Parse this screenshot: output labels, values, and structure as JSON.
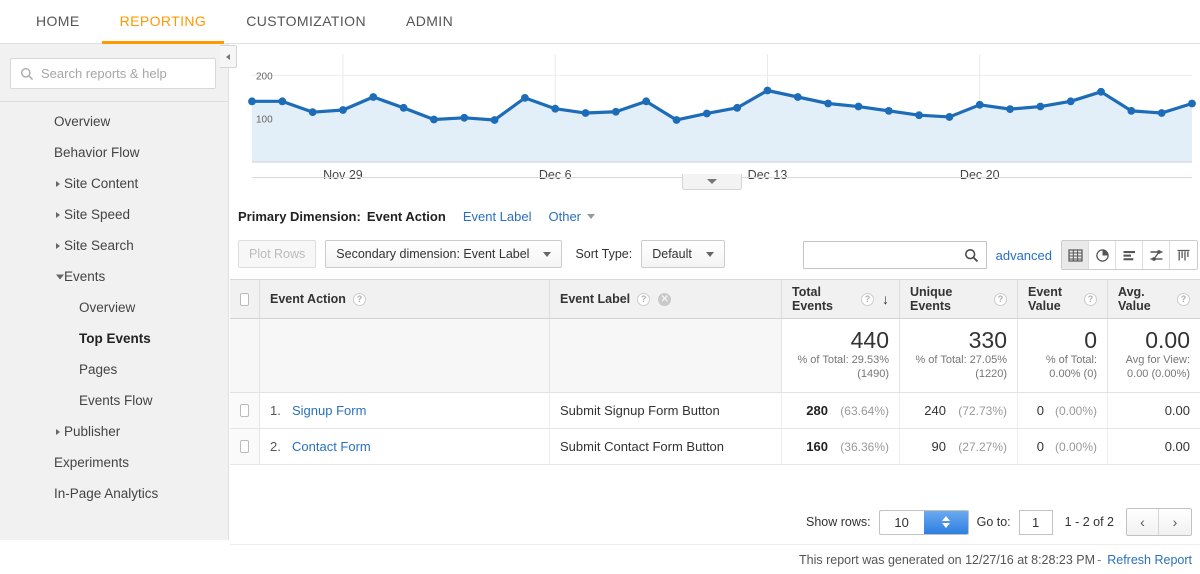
{
  "topnav": {
    "items": [
      {
        "label": "HOME",
        "active": false
      },
      {
        "label": "REPORTING",
        "active": true
      },
      {
        "label": "CUSTOMIZATION",
        "active": false
      },
      {
        "label": "ADMIN",
        "active": false
      }
    ],
    "accent_color": "#ff9900"
  },
  "sidebar": {
    "search": {
      "placeholder": "Search reports & help",
      "value": ""
    },
    "items": [
      {
        "label": "Overview",
        "level": 1,
        "caret": "none",
        "selected": false
      },
      {
        "label": "Behavior Flow",
        "level": 1,
        "caret": "none",
        "selected": false
      },
      {
        "label": "Site Content",
        "level": 1,
        "caret": "closed",
        "selected": false
      },
      {
        "label": "Site Speed",
        "level": 1,
        "caret": "closed",
        "selected": false
      },
      {
        "label": "Site Search",
        "level": 1,
        "caret": "closed",
        "selected": false
      },
      {
        "label": "Events",
        "level": 1,
        "caret": "open",
        "selected": false
      },
      {
        "label": "Overview",
        "level": 2,
        "caret": "none",
        "selected": false
      },
      {
        "label": "Top Events",
        "level": 2,
        "caret": "none",
        "selected": true
      },
      {
        "label": "Pages",
        "level": 2,
        "caret": "none",
        "selected": false
      },
      {
        "label": "Events Flow",
        "level": 2,
        "caret": "none",
        "selected": false
      },
      {
        "label": "Publisher",
        "level": 1,
        "caret": "closed",
        "selected": false
      },
      {
        "label": "Experiments",
        "level": 1,
        "caret": "none",
        "selected": false
      },
      {
        "label": "In-Page Analytics",
        "level": 1,
        "caret": "none",
        "selected": false
      }
    ]
  },
  "chart_data": {
    "type": "line",
    "title": "",
    "xlabel": "",
    "ylabel": "",
    "ylim": [
      0,
      240
    ],
    "yticks": [
      100,
      200
    ],
    "ytick_labels": [
      "100",
      "200"
    ],
    "xtick_labels": [
      "Nov 29",
      "Dec 6",
      "Dec 13",
      "Dec 20"
    ],
    "grid": true,
    "legend": "none",
    "line_color": "#1c6cb8",
    "fill_color": "#e3eff8",
    "values": [
      140,
      140,
      115,
      120,
      150,
      125,
      98,
      102,
      97,
      148,
      123,
      113,
      116,
      140,
      97,
      112,
      125,
      165,
      150,
      135,
      128,
      118,
      108,
      104,
      132,
      122,
      128,
      140,
      162,
      118,
      113,
      135
    ],
    "x": [
      "Nov 26",
      "Nov 27",
      "Nov 28",
      "Nov 29",
      "Nov 30",
      "Dec 1",
      "Dec 2",
      "Dec 3",
      "Dec 4",
      "Dec 5",
      "Dec 6",
      "Dec 7",
      "Dec 8",
      "Dec 9",
      "Dec 10",
      "Dec 11",
      "Dec 12",
      "Dec 13",
      "Dec 14",
      "Dec 15",
      "Dec 16",
      "Dec 17",
      "Dec 18",
      "Dec 19",
      "Dec 20",
      "Dec 21",
      "Dec 22",
      "Dec 23",
      "Dec 24",
      "Dec 25",
      "Dec 26",
      "Dec 27"
    ]
  },
  "primary_dimension": {
    "label": "Primary Dimension:",
    "current": "Event Action",
    "links": [
      "Event Label"
    ],
    "other": "Other"
  },
  "controls": {
    "plot_rows": "Plot Rows",
    "secondary_dimension": "Secondary dimension: Event Label",
    "sort_type_label": "Sort Type:",
    "sort_type_value": "Default",
    "table_search_value": "",
    "advanced": "advanced",
    "view_buttons": [
      {
        "name": "table-view-icon",
        "active": true
      },
      {
        "name": "pie-chart-view-icon",
        "active": false
      },
      {
        "name": "bar-chart-view-icon",
        "active": false
      },
      {
        "name": "comparison-view-icon",
        "active": false
      },
      {
        "name": "pivot-view-icon",
        "active": false
      }
    ]
  },
  "table": {
    "headers": [
      {
        "label": "Event Action",
        "help": true,
        "close": false,
        "sorted": false
      },
      {
        "label": "Event Label",
        "help": true,
        "close": true,
        "sorted": false
      },
      {
        "label": "Total Events",
        "help": true,
        "close": false,
        "sorted": true,
        "sort_dir": "desc"
      },
      {
        "label": "Unique Events",
        "help": true,
        "close": false,
        "sorted": false
      },
      {
        "label": "Event Value",
        "help": true,
        "close": false,
        "sorted": false
      },
      {
        "label": "Avg. Value",
        "help": true,
        "close": false,
        "sorted": false
      }
    ],
    "summary": {
      "total_events": {
        "value": "440",
        "line1": "% of Total: 29.53%",
        "line2": "(1490)"
      },
      "unique_events": {
        "value": "330",
        "line1": "% of Total: 27.05%",
        "line2": "(1220)"
      },
      "event_value": {
        "value": "0",
        "line1": "% of Total:",
        "line2": "0.00% (0)"
      },
      "avg_value": {
        "value": "0.00",
        "line1": "Avg for View:",
        "line2": "0.00 (0.00%)"
      }
    },
    "rows": [
      {
        "num": "1.",
        "event_action": "Signup Form",
        "event_label": "Submit Signup Form Button",
        "total_events": "280",
        "total_events_pct": "(63.64%)",
        "unique_events": "240",
        "unique_events_pct": "(72.73%)",
        "event_value": "0",
        "event_value_pct": "(0.00%)",
        "avg_value": "0.00"
      },
      {
        "num": "2.",
        "event_action": "Contact Form",
        "event_label": "Submit Contact Form Button",
        "total_events": "160",
        "total_events_pct": "(36.36%)",
        "unique_events": "90",
        "unique_events_pct": "(27.27%)",
        "event_value": "0",
        "event_value_pct": "(0.00%)",
        "avg_value": "0.00"
      }
    ]
  },
  "footer": {
    "show_rows_label": "Show rows:",
    "show_rows_value": "10",
    "goto_label": "Go to:",
    "goto_value": "1",
    "range": "1 - 2 of 2",
    "prev": "‹",
    "next": "›",
    "report_note": "This report was generated on 12/27/16 at 8:28:23 PM",
    "note_separator": "-",
    "refresh_link": "Refresh Report"
  }
}
